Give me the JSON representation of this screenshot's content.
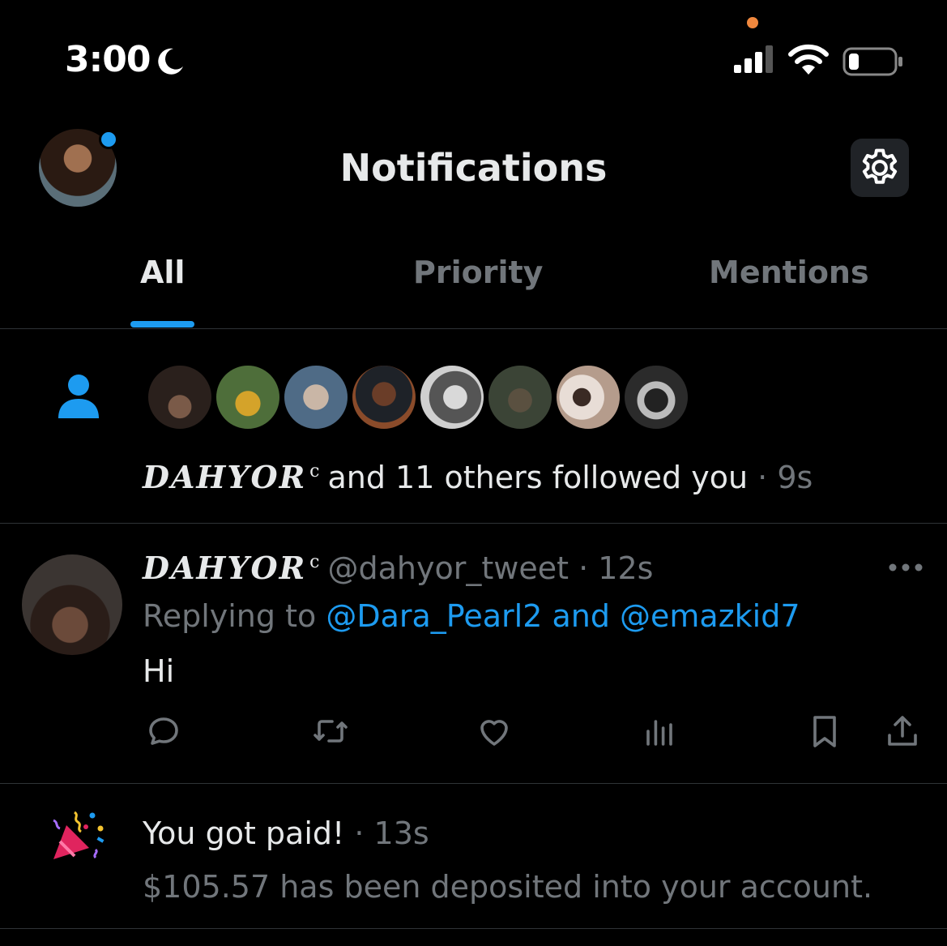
{
  "status_bar": {
    "time": "3:00"
  },
  "header": {
    "title": "Notifications"
  },
  "tabs": [
    {
      "label": "All",
      "active": true
    },
    {
      "label": "Priority",
      "active": false
    },
    {
      "label": "Mentions",
      "active": false
    }
  ],
  "follow_notification": {
    "name": "DAHYOR",
    "name_suffix": "c",
    "text": "and 11 others followed you",
    "separator": "·",
    "time": "9s"
  },
  "tweet": {
    "display_name": "DAHYOR",
    "name_suffix": "c",
    "handle": "@dahyor_tweet",
    "separator": "·",
    "time": "12s",
    "replying_prefix": "Replying to",
    "replying_users": "@Dara_Pearl2 and @emazkid7",
    "body": "Hi"
  },
  "paid_notification": {
    "title": "You got paid!",
    "separator": "·",
    "time": "13s",
    "body": "$105.57 has been deposited into your account."
  },
  "colors": {
    "accent": "#1d9bf0",
    "background": "#000000",
    "text_primary": "#e7e9ea",
    "text_muted": "#71767b",
    "divider": "#2f3336"
  },
  "icons": [
    "moon-icon",
    "signal-icon",
    "wifi-icon",
    "battery-icon",
    "settings-gear-icon",
    "person-icon",
    "more-icon",
    "reply-icon",
    "retweet-icon",
    "like-icon",
    "views-icon",
    "bookmark-icon",
    "share-icon",
    "party-popper-icon"
  ]
}
